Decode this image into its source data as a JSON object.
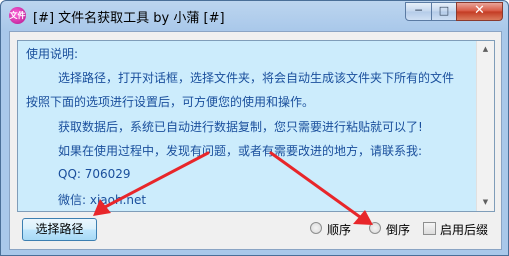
{
  "window": {
    "title": "[#] 文件名获取工具 by 小蒲 [#]",
    "app_icon_text": "文件"
  },
  "titlebar_buttons": {
    "minimize": "─",
    "maximize": "□",
    "close": "✕"
  },
  "info": {
    "lines": [
      "使用说明:",
      "选择路径，打开对话框，选择文件夹，将会自动生成该文件夹下所有的文件",
      "按照下面的选项进行设置后，可方便您的使用和操作。",
      "获取数据后，系统已自动进行数据复制，您只需要进行粘贴就可以了!",
      "如果在使用过程中，发现有问题，或者有需要改进的地方，请联系我:",
      "QQ: 706029",
      "微信: xiaoh.net"
    ]
  },
  "controls": {
    "select_path_label": "选择路径",
    "order_asc_label": "顺序",
    "order_desc_label": "倒序",
    "enable_suffix_label": "启用后缀"
  },
  "colors": {
    "info_background": "#ccecfc",
    "info_text": "#1a4f9c",
    "annotation_arrow": "#e8262a"
  }
}
